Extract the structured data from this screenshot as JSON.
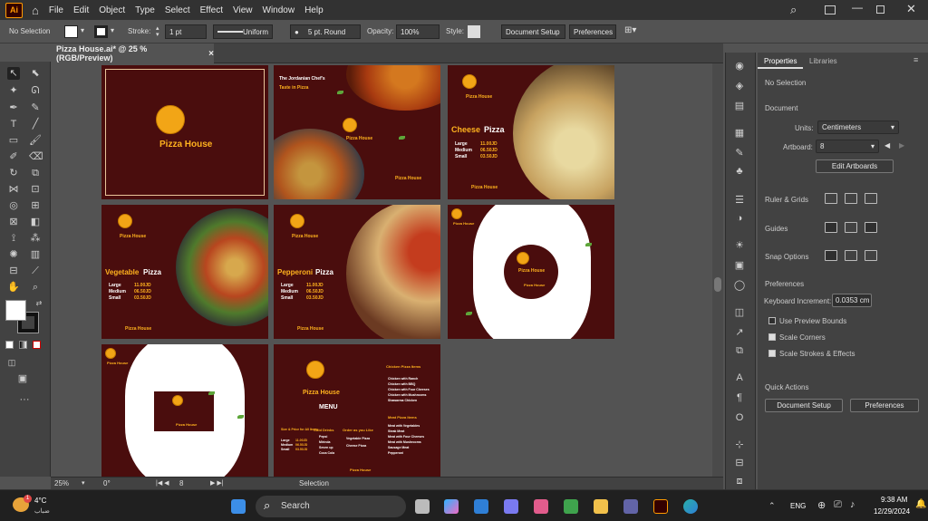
{
  "app": {
    "logo": "Ai",
    "menu": [
      "File",
      "Edit",
      "Object",
      "Type",
      "Select",
      "Effect",
      "View",
      "Window",
      "Help"
    ]
  },
  "control": {
    "selection": "No Selection",
    "stroke_label": "Stroke:",
    "stroke_value": "1 pt",
    "stroke_style": "Uniform",
    "brush": "5 pt. Round",
    "opacity_label": "Opacity:",
    "opacity_value": "100%",
    "style_label": "Style:",
    "doc_setup": "Document Setup",
    "preferences": "Preferences"
  },
  "document": {
    "tab": "Pizza House.ai* @ 25 % (RGB/Preview)",
    "close": "×"
  },
  "artboards": {
    "brand": "Pizza House",
    "a1": {
      "brand": "Pizza House"
    },
    "a2": {
      "t1": "The Jordanian Chef's",
      "t2": "Taste in Pizza",
      "brand": "Pizza House",
      "footer": "Pizza House"
    },
    "a3": {
      "title_w": "Cheese",
      "title_y": "Pizza",
      "brand": "Pizza House",
      "l1": "Large",
      "l2": "Medium",
      "l3": "Small",
      "p1": "11.00JD",
      "p2": "06.50JD",
      "p3": "03.50JD",
      "footer": "Pizza House"
    },
    "a4": {
      "title_w": "Vegetable",
      "title_y": "Pizza",
      "brand": "Pizza House",
      "l1": "Large",
      "l2": "Medium",
      "l3": "Small",
      "p1": "11.00JD",
      "p2": "06.50JD",
      "p3": "03.50JD",
      "footer": "Pizza House"
    },
    "a5": {
      "title_w": "Pepperoni",
      "title_y": "Pizza",
      "brand": "Pizza House",
      "l1": "Large",
      "l2": "Medium",
      "l3": "Small",
      "p1": "11.00JD",
      "p2": "06.50JD",
      "p3": "03.50JD",
      "footer": "Pizza House"
    },
    "a6": {
      "brand": "Pizza House",
      "logo_brand": "Pizza House",
      "footer": "Pizza House"
    },
    "a7": {
      "brand": "Pizza House",
      "footer": "Pizza House"
    },
    "a8": {
      "brand": "Pizza House",
      "menu": "MENU",
      "chicken_title": "Chicken Pizza Items",
      "chicken": [
        "Chicken with Ranch",
        "Chicken with BBQ",
        "Chicken with Four Cheeses",
        "Chicken with Mushrooms",
        "Shawarma Chicken"
      ],
      "meat_title": "Meat Pizza Items",
      "meat": [
        "Meat with Vegetables",
        "Steak Meat",
        "Meat with Four Cheeses",
        "Meat with Mushrooms",
        "Sausage Meat",
        "Pepperoni"
      ],
      "size_title": "Size & Price for All Items",
      "l1": "Large",
      "l2": "Medium",
      "l3": "Small",
      "p1": "11.00JD",
      "p2": "06.50JD",
      "p3": "03.50JD",
      "drinks_title": "Cold Drinks",
      "drinks": [
        "Pepsi",
        "Mirinda",
        "Seven up",
        "Coca Cola"
      ],
      "order_title": "Order as you Like",
      "order": [
        "Vegetable Pizza",
        "Cheese Pizza"
      ],
      "footer": "Pizza House"
    }
  },
  "panel": {
    "tab_properties": "Properties",
    "tab_libraries": "Libraries",
    "no_selection": "No Selection",
    "document": "Document",
    "units_label": "Units:",
    "units_value": "Centimeters",
    "artboard_label": "Artboard:",
    "artboard_value": "8",
    "edit_artboards": "Edit Artboards",
    "ruler_grids": "Ruler & Grids",
    "guides": "Guides",
    "snap": "Snap Options",
    "preferences": "Preferences",
    "kb_label": "Keyboard Increment:",
    "kb_value": "0.0353 cm",
    "preview_bounds": "Use Preview Bounds",
    "scale_corners": "Scale Corners",
    "scale_strokes": "Scale Strokes & Effects",
    "quick_actions": "Quick Actions",
    "doc_setup": "Document Setup",
    "prefs_btn": "Preferences"
  },
  "status": {
    "zoom": "25%",
    "rotate": "0°",
    "artboard": "8",
    "mode": "Selection"
  },
  "taskbar": {
    "weather_temp": "4°C",
    "weather_desc": "ضباب",
    "search": "Search",
    "lang": "ENG",
    "time": "9:38 AM",
    "date": "12/29/2024",
    "badge": "1"
  }
}
